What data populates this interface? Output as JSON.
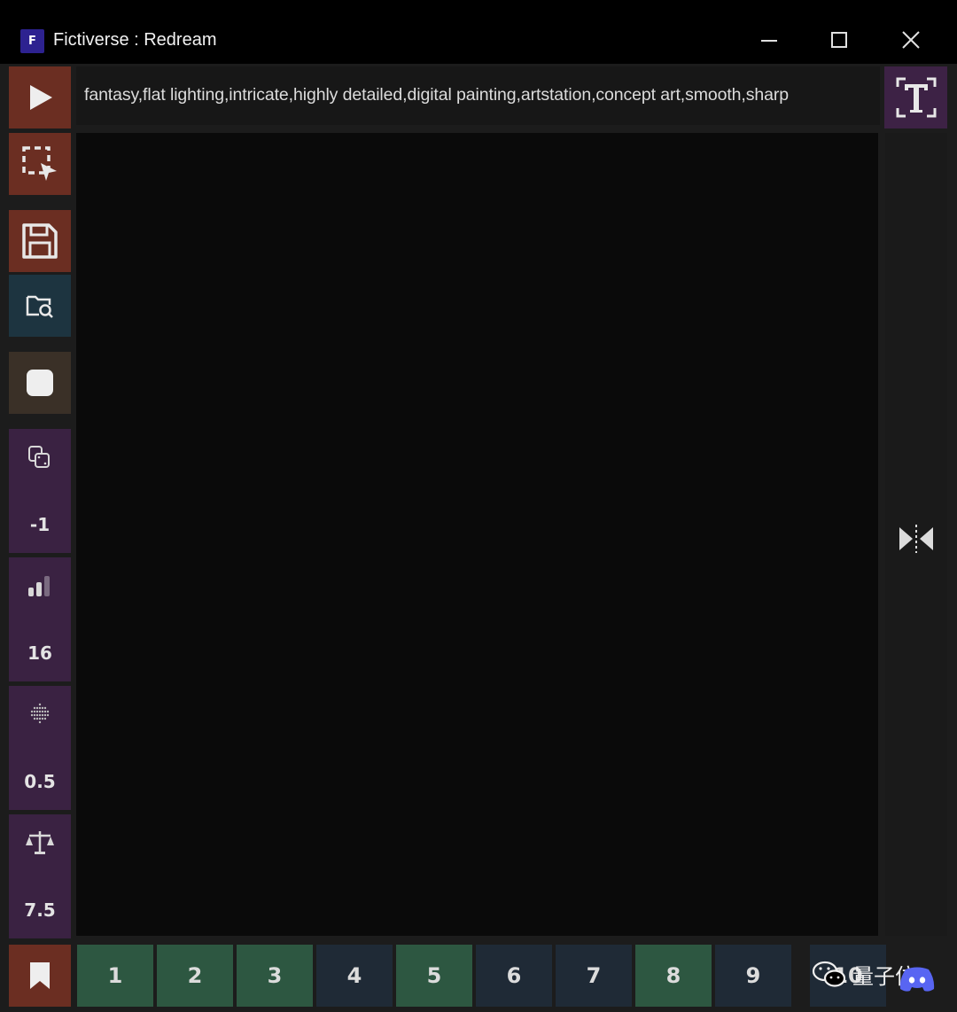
{
  "window": {
    "app_icon_letter": "F",
    "title": "Fictiverse : Redream",
    "controls": [
      "minimize",
      "maximize",
      "close"
    ]
  },
  "toolbar": {
    "prompt": "fantasy,flat lighting,intricate,highly detailed,digital painting,artstation,concept art,smooth,sharp",
    "buttons": [
      {
        "icon": "play-icon",
        "color": "#6b2e22"
      },
      {
        "icon": "select-region-icon",
        "color": "#6b2e22"
      },
      {
        "icon": "save-icon",
        "color": "#6b2e22"
      },
      {
        "icon": "folder-search-icon",
        "color": "#1d3440"
      },
      {
        "icon": "stop-icon",
        "color": "#3a3027"
      }
    ]
  },
  "params": [
    {
      "icon": "dice-icon",
      "value": "-1"
    },
    {
      "icon": "signal-bars-icon",
      "value": "16"
    },
    {
      "icon": "noise-dots-icon",
      "value": "0.5"
    },
    {
      "icon": "scale-balance-icon",
      "value": "7.5"
    }
  ],
  "slots": [
    {
      "label": "1",
      "color": "#2d5741"
    },
    {
      "label": "2",
      "color": "#2d5741"
    },
    {
      "label": "3",
      "color": "#2d5741"
    },
    {
      "label": "4",
      "color": "#1f2a36"
    },
    {
      "label": "5",
      "color": "#2d5741"
    },
    {
      "label": "6",
      "color": "#1f2a36"
    },
    {
      "label": "7",
      "color": "#1f2a36"
    },
    {
      "label": "8",
      "color": "#2d5741"
    },
    {
      "label": "9",
      "color": "#1f2a36"
    },
    {
      "label": "10",
      "color": "#1f2a36"
    }
  ],
  "watermark": {
    "text": "量子位"
  }
}
